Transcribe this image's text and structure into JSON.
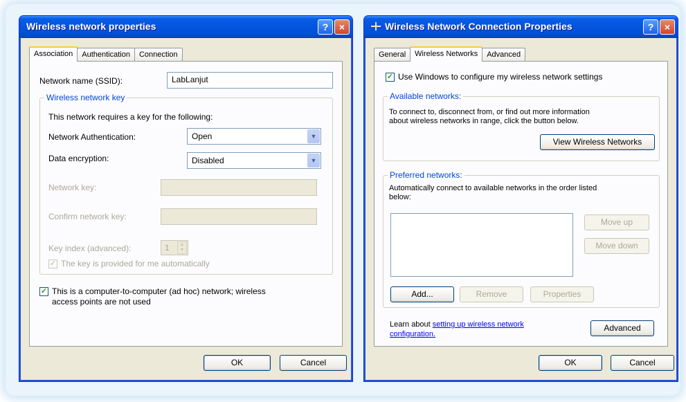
{
  "left_dialog": {
    "title": "Wireless network properties",
    "help_label": "?",
    "close_label": "×",
    "tabs": [
      "Association",
      "Authentication",
      "Connection"
    ],
    "ssid_label": "Network name (SSID):",
    "ssid_value": "LabLanjut",
    "key_group_label": "Wireless network key",
    "key_requirement_text": "This network requires a key for the following:",
    "auth_label": "Network Authentication:",
    "auth_value": "Open",
    "encryption_label": "Data encryption:",
    "encryption_value": "Disabled",
    "network_key_label": "Network key:",
    "confirm_key_label": "Confirm network key:",
    "key_index_label": "Key index (advanced):",
    "key_index_value": "1",
    "auto_key_label": "The key is provided for me automatically",
    "adhoc_label_line1": "This is a computer-to-computer (ad hoc) network; wireless",
    "adhoc_label_line2": "access points are not used",
    "ok_label": "OK",
    "cancel_label": "Cancel"
  },
  "right_dialog": {
    "title": "Wireless Network Connection Properties",
    "help_label": "?",
    "close_label": "×",
    "tabs": [
      "General",
      "Wireless Networks",
      "Advanced"
    ],
    "use_windows_label": "Use Windows to configure my wireless network settings",
    "available_group_label": "Available networks:",
    "available_text_line1": "To connect to, disconnect from, or find out more information",
    "available_text_line2": "about wireless networks in range, click the button below.",
    "view_networks_label": "View Wireless Networks",
    "preferred_group_label": "Preferred networks:",
    "preferred_text_line1": "Automatically connect to available networks in the order listed",
    "preferred_text_line2": "below:",
    "move_up_label": "Move up",
    "move_down_label": "Move down",
    "add_label": "Add...",
    "remove_label": "Remove",
    "properties_label": "Properties",
    "learn_prefix": "Learn about",
    "learn_link_line1": "setting up wireless network",
    "learn_link_line2": "configuration.",
    "advanced_button_label": "Advanced",
    "ok_label": "OK",
    "cancel_label": "Cancel"
  },
  "colors": {
    "title_bar_blue": "#0454e0",
    "dialog_face": "#ece9d8",
    "group_label_blue": "#0046d5",
    "active_tab_accent": "#ffc83c",
    "close_button_red": "#d2452a"
  }
}
